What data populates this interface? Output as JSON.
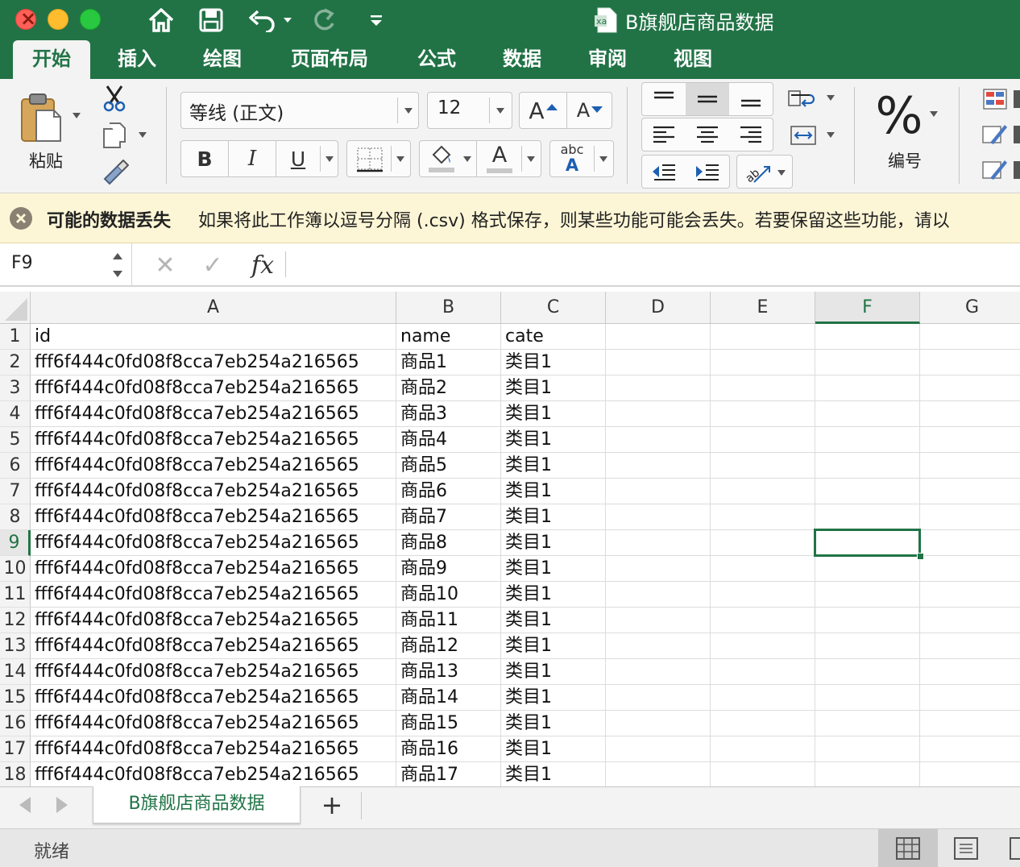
{
  "window": {
    "title": "B旗舰店商品数据",
    "doc_icon_letters": "xa"
  },
  "quick_access": [
    {
      "name": "home-icon"
    },
    {
      "name": "save-icon"
    },
    {
      "name": "undo-icon"
    },
    {
      "name": "redo-icon"
    },
    {
      "name": "customize-toolbar-icon"
    }
  ],
  "tabs": [
    {
      "label": "开始",
      "active": true
    },
    {
      "label": "插入"
    },
    {
      "label": "绘图"
    },
    {
      "label": "页面布局"
    },
    {
      "label": "公式"
    },
    {
      "label": "数据"
    },
    {
      "label": "审阅"
    },
    {
      "label": "视图"
    }
  ],
  "ribbon": {
    "paste_label": "粘贴",
    "font_name": "等线 (正文)",
    "font_size": "12",
    "bold": "B",
    "italic": "I",
    "underline": "U",
    "increase_font": "A",
    "decrease_font": "A",
    "font_color": "A",
    "phonetic_top": "abc",
    "phonetic_bottom": "A",
    "number_symbol": "%",
    "number_label": "编号"
  },
  "message": {
    "title": "可能的数据丢失",
    "text": "如果将此工作簿以逗号分隔 (.csv) 格式保存，则某些功能可能会丢失。若要保留这些功能，请以"
  },
  "formula_bar": {
    "name_box": "F9",
    "cancel": "✕",
    "enter": "✓",
    "fx": "fx",
    "content": ""
  },
  "grid": {
    "columns": [
      "A",
      "B",
      "C",
      "D",
      "E",
      "F",
      "G"
    ],
    "active_column": "F",
    "active_row": "9",
    "rows": [
      {
        "num": "1",
        "cells": [
          "id",
          "name",
          "cate"
        ]
      },
      {
        "num": "2",
        "cells": [
          "fff6f444c0fd08f8cca7eb254a216565",
          "商品1",
          "类目1"
        ]
      },
      {
        "num": "3",
        "cells": [
          "fff6f444c0fd08f8cca7eb254a216565",
          "商品2",
          "类目1"
        ]
      },
      {
        "num": "4",
        "cells": [
          "fff6f444c0fd08f8cca7eb254a216565",
          "商品3",
          "类目1"
        ]
      },
      {
        "num": "5",
        "cells": [
          "fff6f444c0fd08f8cca7eb254a216565",
          "商品4",
          "类目1"
        ]
      },
      {
        "num": "6",
        "cells": [
          "fff6f444c0fd08f8cca7eb254a216565",
          "商品5",
          "类目1"
        ]
      },
      {
        "num": "7",
        "cells": [
          "fff6f444c0fd08f8cca7eb254a216565",
          "商品6",
          "类目1"
        ]
      },
      {
        "num": "8",
        "cells": [
          "fff6f444c0fd08f8cca7eb254a216565",
          "商品7",
          "类目1"
        ]
      },
      {
        "num": "9",
        "cells": [
          "fff6f444c0fd08f8cca7eb254a216565",
          "商品8",
          "类目1"
        ]
      },
      {
        "num": "10",
        "cells": [
          "fff6f444c0fd08f8cca7eb254a216565",
          "商品9",
          "类目1"
        ]
      },
      {
        "num": "11",
        "cells": [
          "fff6f444c0fd08f8cca7eb254a216565",
          "商品10",
          "类目1"
        ]
      },
      {
        "num": "12",
        "cells": [
          "fff6f444c0fd08f8cca7eb254a216565",
          "商品11",
          "类目1"
        ]
      },
      {
        "num": "13",
        "cells": [
          "fff6f444c0fd08f8cca7eb254a216565",
          "商品12",
          "类目1"
        ]
      },
      {
        "num": "14",
        "cells": [
          "fff6f444c0fd08f8cca7eb254a216565",
          "商品13",
          "类目1"
        ]
      },
      {
        "num": "15",
        "cells": [
          "fff6f444c0fd08f8cca7eb254a216565",
          "商品14",
          "类目1"
        ]
      },
      {
        "num": "16",
        "cells": [
          "fff6f444c0fd08f8cca7eb254a216565",
          "商品15",
          "类目1"
        ]
      },
      {
        "num": "17",
        "cells": [
          "fff6f444c0fd08f8cca7eb254a216565",
          "商品16",
          "类目1"
        ]
      },
      {
        "num": "18",
        "cells": [
          "fff6f444c0fd08f8cca7eb254a216565",
          "商品17",
          "类目1"
        ]
      }
    ]
  },
  "sheets": {
    "tabs": [
      {
        "label": "B旗舰店商品数据",
        "active": true
      }
    ],
    "add": "+"
  },
  "status": {
    "text": "就绪"
  },
  "colors": {
    "accent": "#217346",
    "ribbon_bg": "#f3f3f3",
    "warning_bg": "#fdf6d6"
  }
}
